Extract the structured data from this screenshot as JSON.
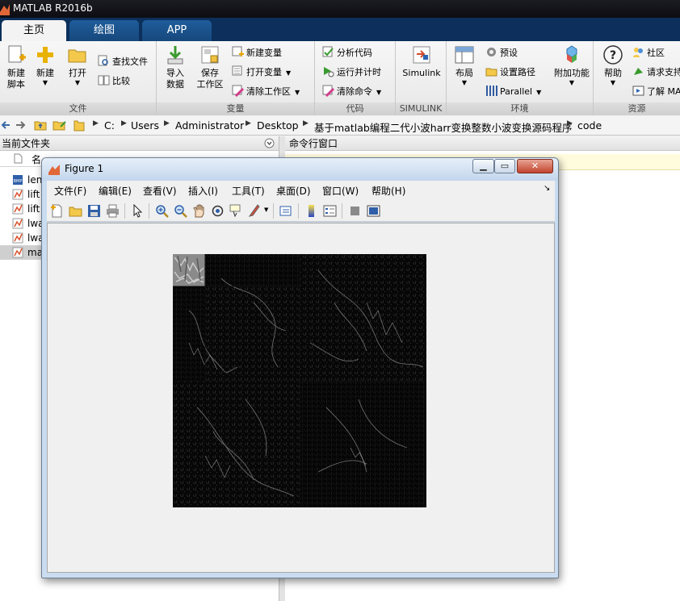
{
  "app": {
    "title": "MATLAB R2016b"
  },
  "tabs": [
    {
      "label": "主页",
      "active": true
    },
    {
      "label": "绘图",
      "active": false
    },
    {
      "label": "APP",
      "active": false
    }
  ],
  "ribbon": {
    "sections": {
      "file": "文件",
      "variable": "变量",
      "code": "代码",
      "simulink": "SIMULINK",
      "environment": "环境",
      "resources": "资源"
    },
    "new_script": "新建\n脚本",
    "new": "新建",
    "open": "打开",
    "find_files": "查找文件",
    "compare": "比较",
    "import_data": "导入\n数据",
    "save_workspace": "保存\n工作区",
    "new_variable": "新建变量",
    "open_variable": "打开变量",
    "clear_workspace": "清除工作区",
    "analyze_code": "分析代码",
    "run_and_time": "运行并计时",
    "clear_commands": "清除命令",
    "simulink": "Simulink",
    "layout": "布局",
    "preferences": "预设",
    "set_path": "设置路径",
    "parallel": "Parallel",
    "addons": "附加功能",
    "help": "帮助",
    "community": "社区",
    "request_support": "请求支持",
    "learn_matlab": "了解 MA"
  },
  "address": {
    "crumbs": [
      "C:",
      "Users",
      "Administrator",
      "Desktop",
      "基于matlab编程二代小波harr变换整数小波变换源码程序",
      "code"
    ]
  },
  "left_panel": {
    "title": "当前文件夹",
    "column_name": "名",
    "files": [
      {
        "name": "len",
        "icon": "bmp-icon"
      },
      {
        "name": "lift",
        "icon": "m-file-icon"
      },
      {
        "name": "lift",
        "icon": "m-file-icon"
      },
      {
        "name": "lwa",
        "icon": "m-file-icon"
      },
      {
        "name": "lwa",
        "icon": "m-file-icon"
      },
      {
        "name": "ma",
        "icon": "m-file-icon"
      }
    ]
  },
  "command_window": {
    "title": "命令行窗口"
  },
  "figure": {
    "title": "Figure 1",
    "menu": [
      "文件(F)",
      "编辑(E)",
      "查看(V)",
      "插入(I)",
      "工具(T)",
      "桌面(D)",
      "窗口(W)",
      "帮助(H)"
    ],
    "toolbar": [
      "new-figure-icon",
      "open-icon",
      "save-icon",
      "print-icon",
      "pointer-icon",
      "zoom-in-icon",
      "zoom-out-icon",
      "pan-icon",
      "rotate-icon",
      "data-cursor-icon",
      "brush-icon",
      "link-icon",
      "colorbar-icon",
      "legend-icon",
      "hide-plot-tools-icon",
      "show-plot-tools-icon"
    ]
  },
  "colors": {
    "titlebar": "#111117",
    "tabstrip": "#0c2f5c",
    "tab_inactive": "#1a5189",
    "ribbon": "#f0f0f0",
    "selected_row": "#cfcfcf",
    "notice": "#fffbdd"
  }
}
